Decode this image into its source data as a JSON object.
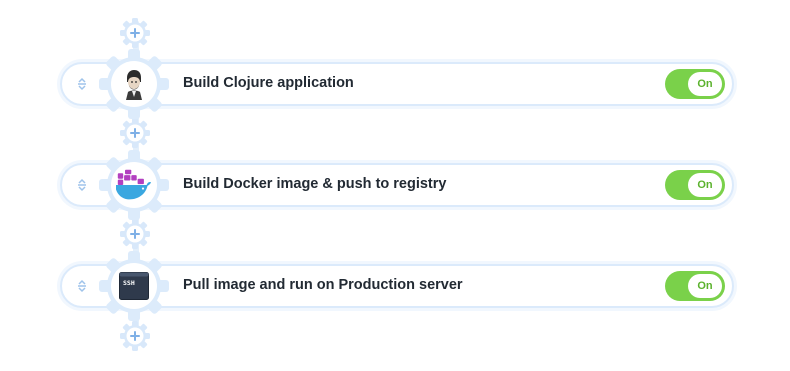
{
  "steps": [
    {
      "label": "Build Clojure application",
      "toggle": "On",
      "icon": "clojure-portrait-icon"
    },
    {
      "label": "Build Docker image & push to registry",
      "toggle": "On",
      "icon": "docker-whale-icon"
    },
    {
      "label": "Pull image and run on Production server",
      "toggle": "On",
      "icon": "ssh-terminal-icon",
      "icon_text": "SSH"
    }
  ],
  "colors": {
    "toggle_on": "#7ad14a",
    "border": "#dbeafb",
    "accent": "#7fb0e6",
    "docker_blue": "#3aa7e0",
    "docker_container": "#b23fc0",
    "label": "#222a33"
  }
}
